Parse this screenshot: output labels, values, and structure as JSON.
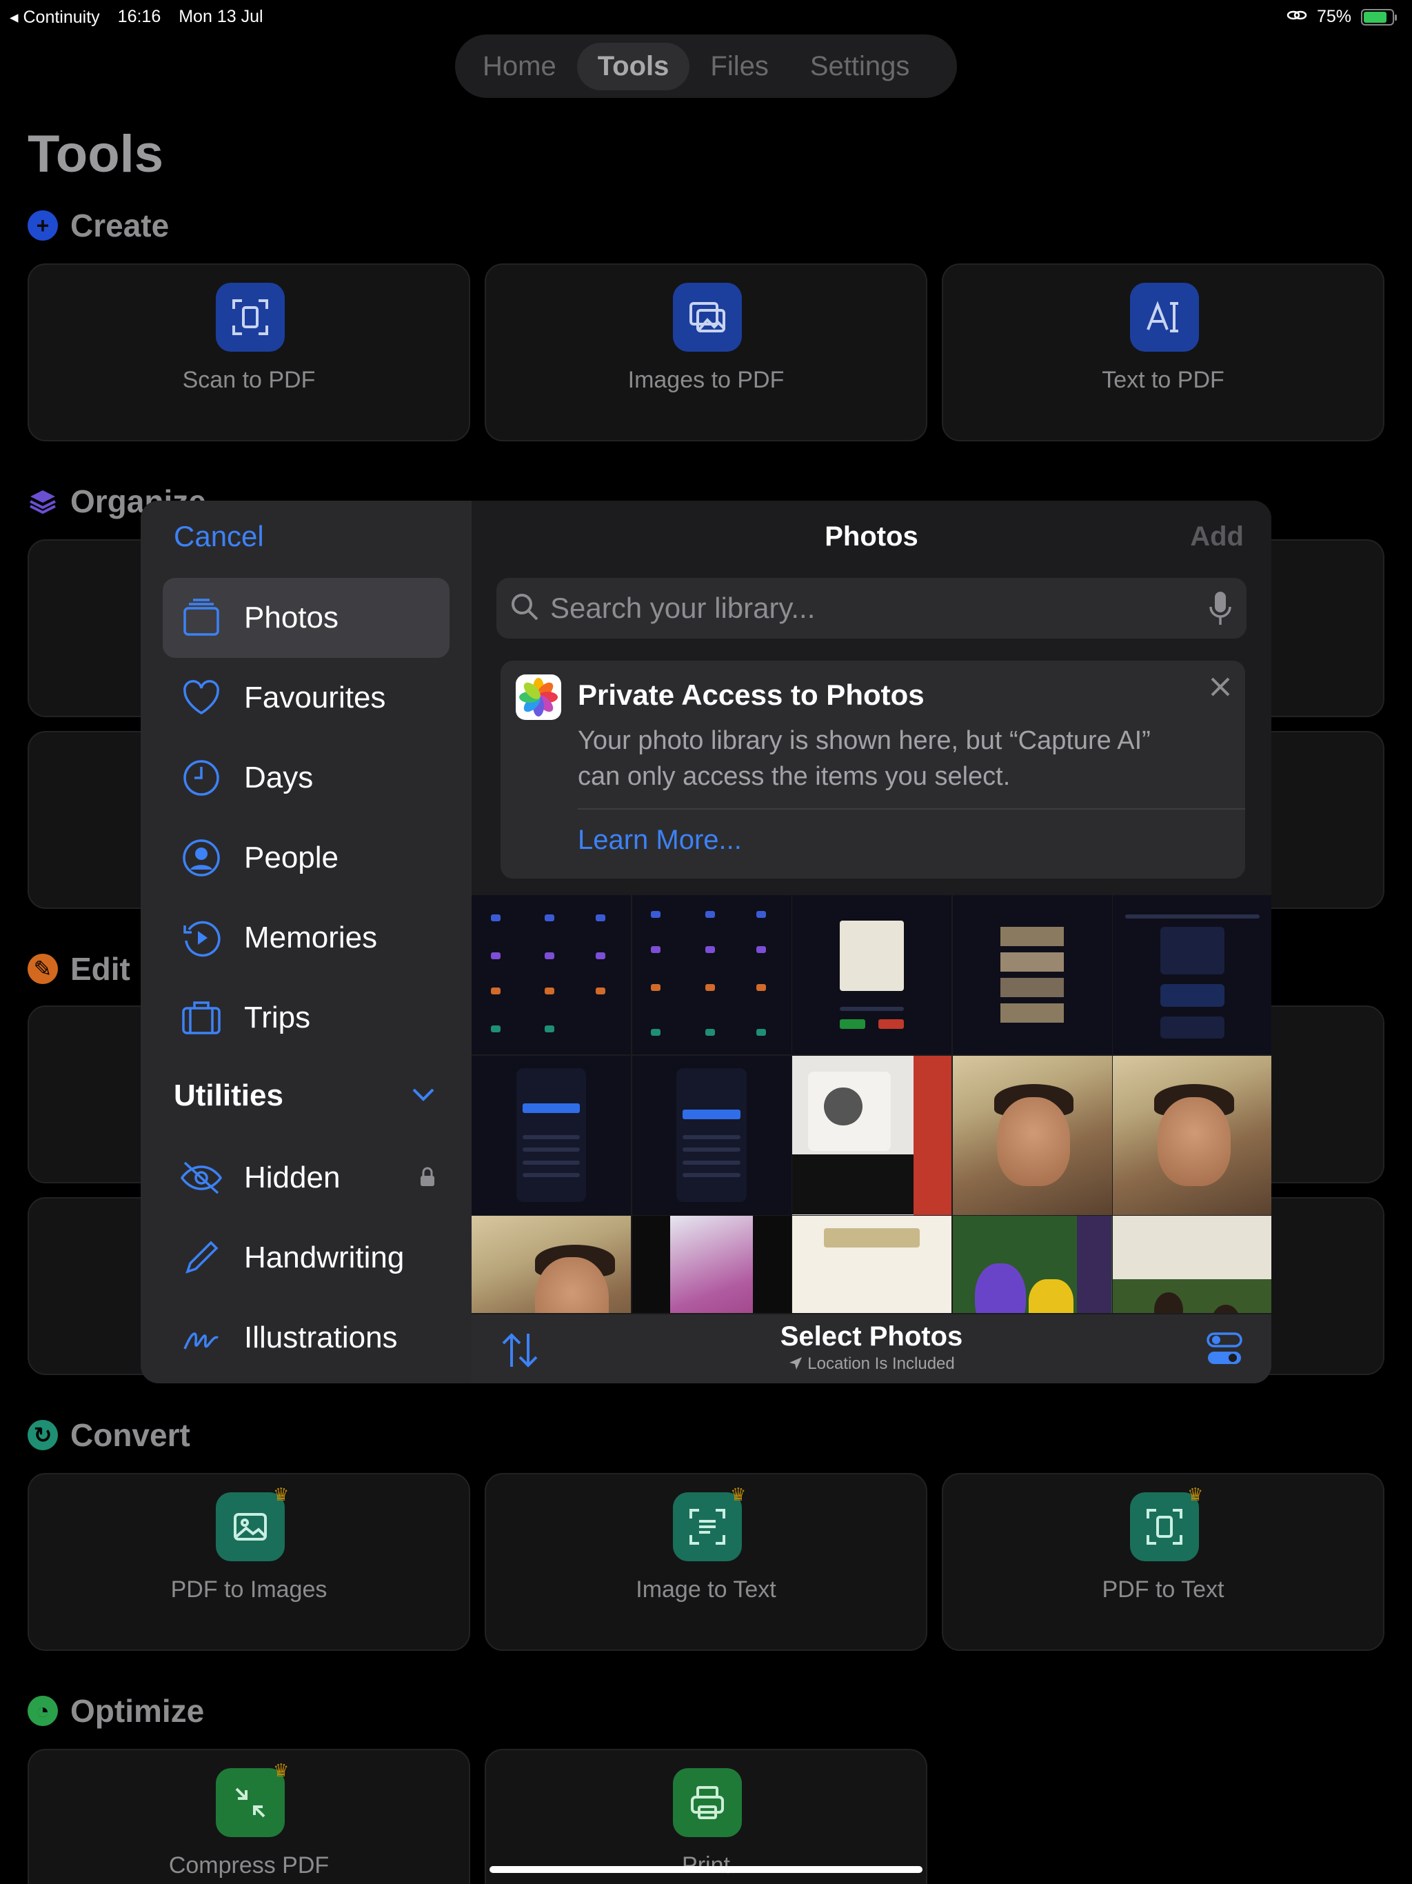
{
  "status": {
    "back_app": "◂ Continuity",
    "time": "16:16",
    "date": "Mon 13 Jul",
    "battery": "75%"
  },
  "segments": [
    "Home",
    "Tools",
    "Files",
    "Settings"
  ],
  "page_title": "Tools",
  "sections": {
    "create": {
      "title": "Create",
      "items": [
        "Scan to PDF",
        "Images to PDF",
        "Text to PDF"
      ]
    },
    "organize": {
      "title": "Organize"
    },
    "edit": {
      "title": "Edit"
    },
    "convert": {
      "title": "Convert",
      "items": [
        "PDF to Images",
        "Image to Text",
        "PDF to Text"
      ]
    },
    "optimize": {
      "title": "Optimize",
      "items": [
        "Compress PDF",
        "Print"
      ]
    }
  },
  "picker": {
    "cancel": "Cancel",
    "title": "Photos",
    "add": "Add",
    "sidebar": [
      {
        "label": "Photos",
        "icon": "photos-stack-icon"
      },
      {
        "label": "Favourites",
        "icon": "heart-icon"
      },
      {
        "label": "Days",
        "icon": "clock-icon"
      },
      {
        "label": "People",
        "icon": "person-circle-icon"
      },
      {
        "label": "Memories",
        "icon": "memories-play-icon"
      },
      {
        "label": "Trips",
        "icon": "suitcase-icon"
      }
    ],
    "utilities": "Utilities",
    "utilities_items": [
      {
        "label": "Hidden",
        "icon": "eye-slash-icon"
      },
      {
        "label": "Handwriting",
        "icon": "pencil-icon"
      },
      {
        "label": "Illustrations",
        "icon": "scribble-icon"
      }
    ],
    "search_placeholder": "Search your library...",
    "banner": {
      "title": "Private Access to Photos",
      "description": "Your photo library is shown here, but “Capture AI” can only access the items you select.",
      "link": "Learn More..."
    },
    "footer": {
      "title": "Select Photos",
      "subtitle": "Location Is Included"
    }
  },
  "colors": {
    "accent": "#3d82f6",
    "create": "#1f4bd1",
    "convert": "#1f8f73",
    "optimize": "#2aa04a",
    "edit": "#d2691e",
    "organize": "#6a4fd1"
  }
}
